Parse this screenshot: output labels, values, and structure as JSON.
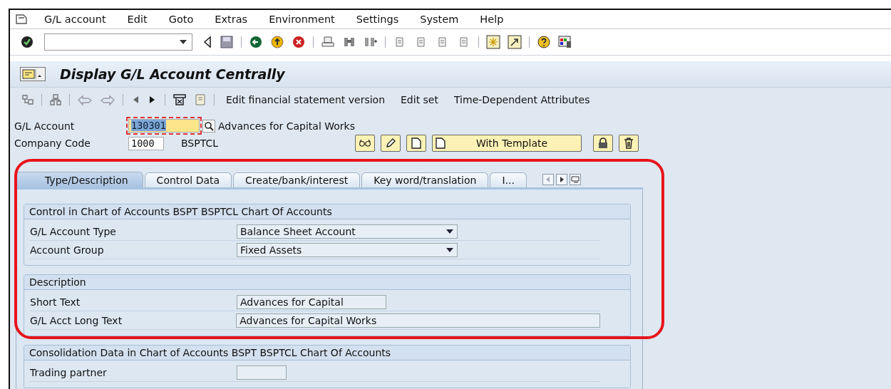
{
  "menu": [
    "G/L account",
    "Edit",
    "Goto",
    "Extras",
    "Environment",
    "Settings",
    "System",
    "Help"
  ],
  "title": "Display G/L Account Centrally",
  "app_toolbar": [
    "Edit financial statement version",
    "Edit set",
    "Time-Dependent Attributes"
  ],
  "header_fields": [
    {
      "label": "G/L Account",
      "value": "130301",
      "description": "Advances for Capital Works",
      "selected": true
    },
    {
      "label": "Company Code",
      "value": "1000",
      "description": "BSPTCL",
      "selected": false
    }
  ],
  "buttons": [
    "With Template"
  ],
  "tabs": [
    {
      "label": "Type/Description",
      "selected": true
    },
    {
      "label": "Control Data",
      "selected": false
    },
    {
      "label": "Create/bank/interest",
      "selected": false
    },
    {
      "label": "Key word/translation",
      "selected": false
    },
    {
      "label": "I...",
      "selected": false
    }
  ],
  "groups": [
    {
      "title": "Control in Chart of Accounts BSPT BSPTCL Chart Of Accounts",
      "rows": [
        {
          "label": "G/L Account Type",
          "value": "Balance Sheet Account",
          "kind": "dropdown"
        },
        {
          "label": "Account Group",
          "value": "Fixed Assets",
          "kind": "dropdown"
        }
      ]
    },
    {
      "title": "Description",
      "rows": [
        {
          "label": "Short Text",
          "value": "Advances for Capital",
          "kind": "short"
        },
        {
          "label": "G/L Acct Long Text",
          "value": "Advances for Capital Works",
          "kind": "long"
        }
      ]
    },
    {
      "title": "Consolidation Data in Chart of Accounts BSPT BSPTCL Chart Of Accounts",
      "rows": [
        {
          "label": "Trading partner",
          "kind": "tiny"
        }
      ]
    }
  ]
}
